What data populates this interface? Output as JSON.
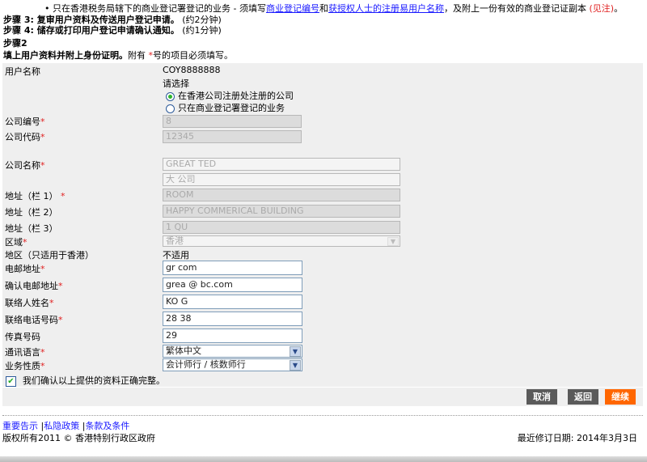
{
  "intro": {
    "bullet_text": "只在香港税务局辖下的商业登记署登记的业务 - 须填写",
    "link1": "商业登记编号",
    "and": "和",
    "link2": "获授权人士的注册易用户名称",
    "after": "，及附上一份有效的商业登记证副本",
    "note_link": "(见注)",
    "end": "。"
  },
  "steps": [
    {
      "title": "步骤 3: 复审用户资料及传送用户登记申请。",
      "time": "(约2分钟)"
    },
    {
      "title": "步骤 4: 储存或打印用户登记申请确认通知。",
      "time": "(约1分钟)"
    }
  ],
  "section": {
    "step": "步骤2",
    "heading": "填上用户资料并附上身份证明。",
    "note_pre": "附有",
    "star": "*",
    "note_post": "号的项目必须填写。"
  },
  "form": {
    "username_label": "用户名称",
    "username_value": "COY8888888",
    "choose_label": "请选择",
    "radio_options": [
      {
        "label": "在香港公司注册处注册的公司",
        "selected": true
      },
      {
        "label": "只在商业登记署登记的业务",
        "selected": false
      }
    ],
    "company_no_label": "公司编号",
    "company_no_value": "8",
    "company_code_label": "公司代码",
    "company_code_value": "12345",
    "company_name_label": "公司名称",
    "company_name_en": "GREAT                         TED",
    "company_name_zh": "大          公司",
    "addr1_label": "地址（栏 1）",
    "addr1_value": "ROOM",
    "addr2_label": "地址（栏 2）",
    "addr2_value": "HAPPY COMMERICAL BUILDING",
    "addr3_label": "地址（栏 3）",
    "addr3_value": "1 QU",
    "region_label": "区域",
    "region_value": "香港",
    "district_label": "地区（只适用于香港）",
    "district_value": "不适用",
    "email_label": "电邮地址",
    "email_value": "gr                    com",
    "email_confirm_label": "确认电邮地址",
    "email_confirm_value": "grea               @    bc.com",
    "contact_label": "联络人姓名",
    "contact_value": "KO G",
    "tel_label": "联络电话号码",
    "tel_value": "28       38",
    "fax_label": "传真号码",
    "fax_value": "29",
    "lang_label": "通讯语言",
    "lang_value": "繁体中文",
    "biz_label": "业务性质",
    "biz_value": "会计师行 / 核数师行",
    "confirm_checkbox": {
      "label": "我们确认以上提供的资料正确完整。",
      "checked": true
    },
    "required_mark": "*"
  },
  "buttons": {
    "cancel": "取消",
    "back": "返回",
    "continue": "继续"
  },
  "colors": {
    "button_gray": "#5a5a5a",
    "button_orange": "#ff6600",
    "form_bg": "#efefef"
  },
  "footer": {
    "links": [
      "重要告示",
      "私隐政策",
      "条款及条件"
    ],
    "sep": "|",
    "copyright": "版权所有2011 © 香港特别行政区政府",
    "revised": "最近修订日期: 2014年3月3日"
  }
}
